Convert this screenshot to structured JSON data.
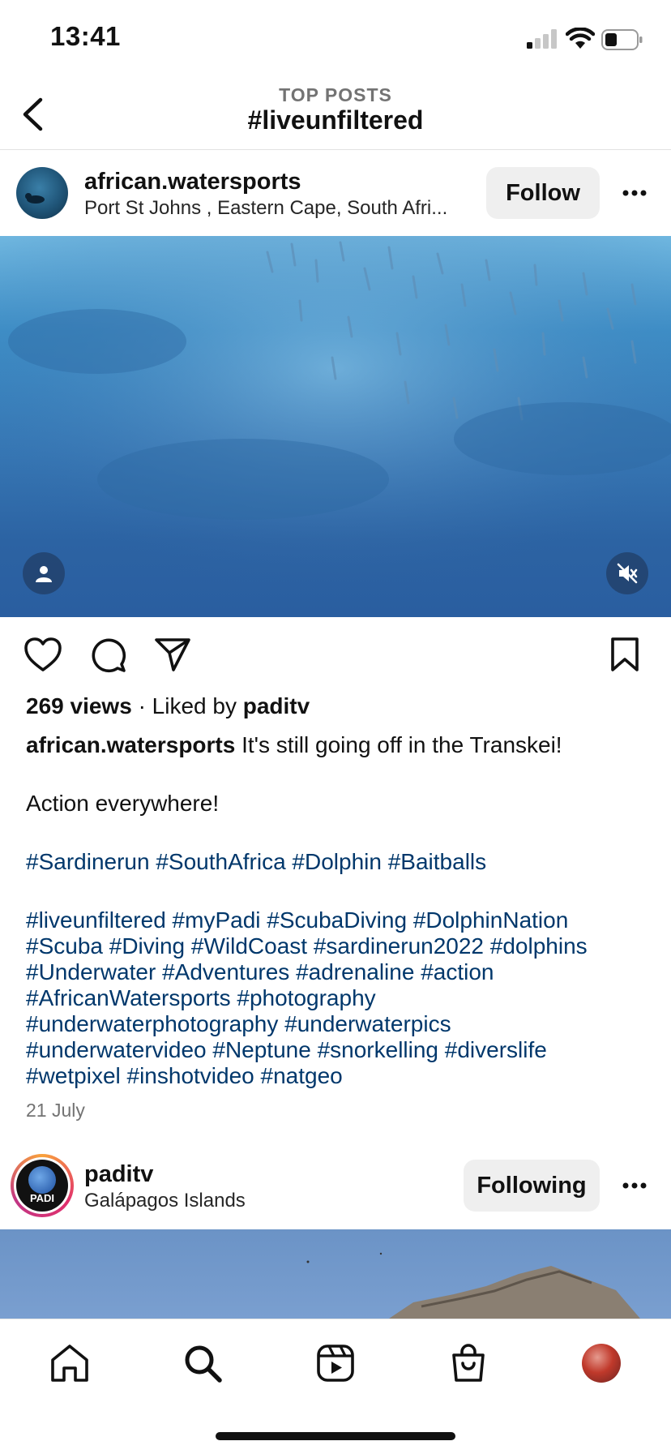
{
  "status_bar": {
    "time": "13:41"
  },
  "header": {
    "subtitle": "TOP POSTS",
    "title": "#liveunfiltered"
  },
  "post1": {
    "username": "african.watersports",
    "location": "Port St Johns , Eastern Cape, South Afri...",
    "follow_label": "Follow",
    "views": "269 views",
    "liked_by_prefix": "Liked by",
    "liked_by_user": "paditv",
    "caption_user": "african.watersports",
    "caption_line1": "It's still going off in the Transkei!",
    "caption_line2": "Action everywhere!",
    "hashtags_line1": "#Sardinerun #SouthAfrica #Dolphin #Baitballs",
    "hashtag_lines": [
      "#liveunfiltered #myPadi #ScubaDiving #DolphinNation",
      "#Scuba #Diving #WildCoast #sardinerun2022 #dolphins",
      "#Underwater #Adventures #adrenaline #action",
      "#AfricanWatersports #photography",
      "#underwaterphotography #underwaterpics",
      "#underwatervideo #Neptune #snorkelling #diverslife",
      "#wetpixel #inshotvideo #natgeo"
    ],
    "date": "21 July"
  },
  "post2": {
    "username": "paditv",
    "location": "Galápagos Islands",
    "following_label": "Following",
    "avatar_text": "PADI"
  },
  "icons": {
    "back": "chevron-left-icon",
    "more": "more-horizontal-icon",
    "like": "heart-icon",
    "comment": "comment-icon",
    "share": "send-icon",
    "save": "bookmark-icon",
    "tags": "user-tag-icon",
    "mute": "speaker-muted-icon",
    "nav": [
      "home-icon",
      "search-icon",
      "reels-icon",
      "shop-icon",
      "profile-avatar"
    ]
  },
  "colors": {
    "hashtag": "#00376b",
    "secondary_text": "#737373",
    "button_bg": "#efefef"
  }
}
